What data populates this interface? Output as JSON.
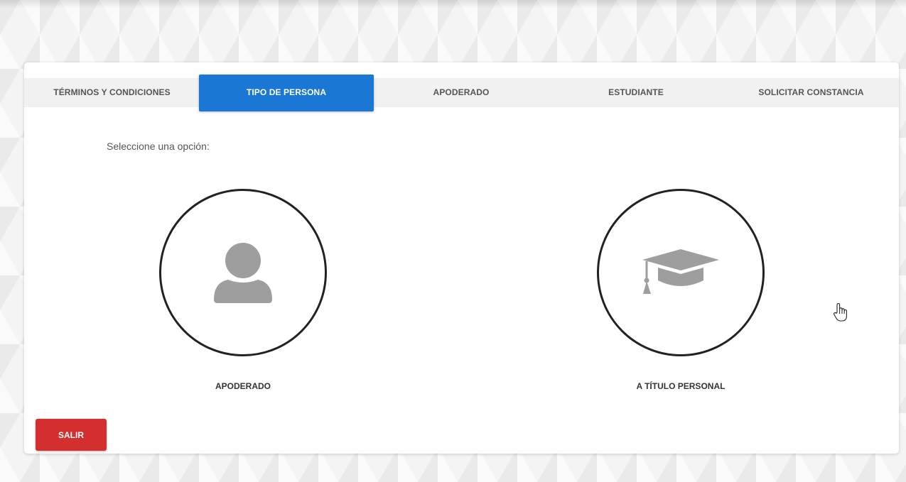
{
  "tabs": [
    {
      "label": "TÉRMINOS Y CONDICIONES",
      "active": false
    },
    {
      "label": "TIPO DE PERSONA",
      "active": true
    },
    {
      "label": "APODERADO",
      "active": false
    },
    {
      "label": "ESTUDIANTE",
      "active": false
    },
    {
      "label": "SOLICITAR CONSTANCIA",
      "active": false
    }
  ],
  "instruction": "Seleccione una opción:",
  "options": [
    {
      "label": "APODERADO",
      "icon": "person-icon"
    },
    {
      "label": "A TÍTULO PERSONAL",
      "icon": "graduation-cap-icon"
    }
  ],
  "exit_label": "SALIR",
  "colors": {
    "accent": "#1a77d4",
    "danger": "#d32f2f",
    "icon_gray": "#9e9e9e",
    "circle_border": "#222222"
  }
}
